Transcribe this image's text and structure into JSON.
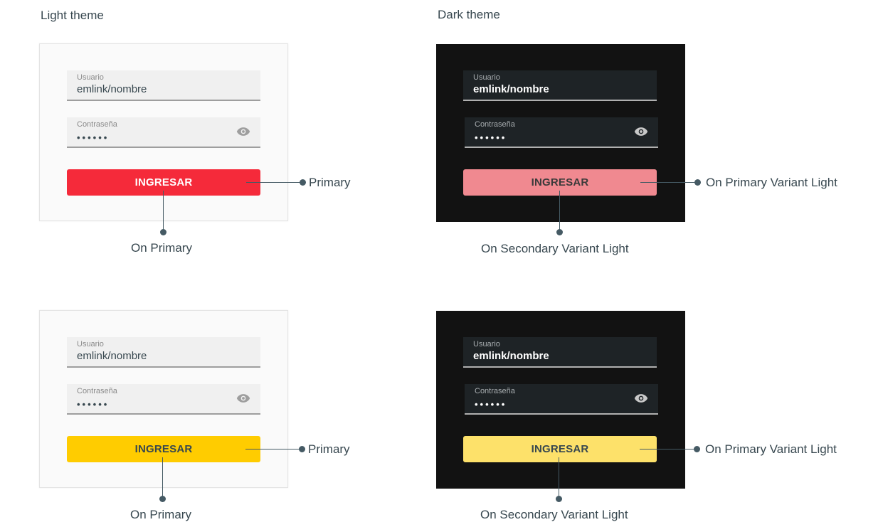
{
  "sections": {
    "light_title": "Light theme",
    "dark_title": "Dark theme"
  },
  "form": {
    "username_label": "Usuario",
    "username_value": "emlink/nombre",
    "password_label": "Contraseña",
    "password_value": "••••••",
    "button_label": "INGRESAR"
  },
  "callouts": {
    "primary": "Primary",
    "on_primary": "On Primary",
    "on_primary_variant_light": "On Primary Variant Light",
    "on_secondary_variant_light": "On Secondary Variant Light"
  },
  "colors": {
    "red_primary": "#f52a3a",
    "red_primary_light": "#f08990",
    "yellow_primary": "#ffcc00",
    "yellow_primary_light": "#fde16a",
    "dark_bg": "#121212",
    "light_bg": "#fafafa"
  },
  "icons": {
    "password_toggle": "eye-icon"
  }
}
